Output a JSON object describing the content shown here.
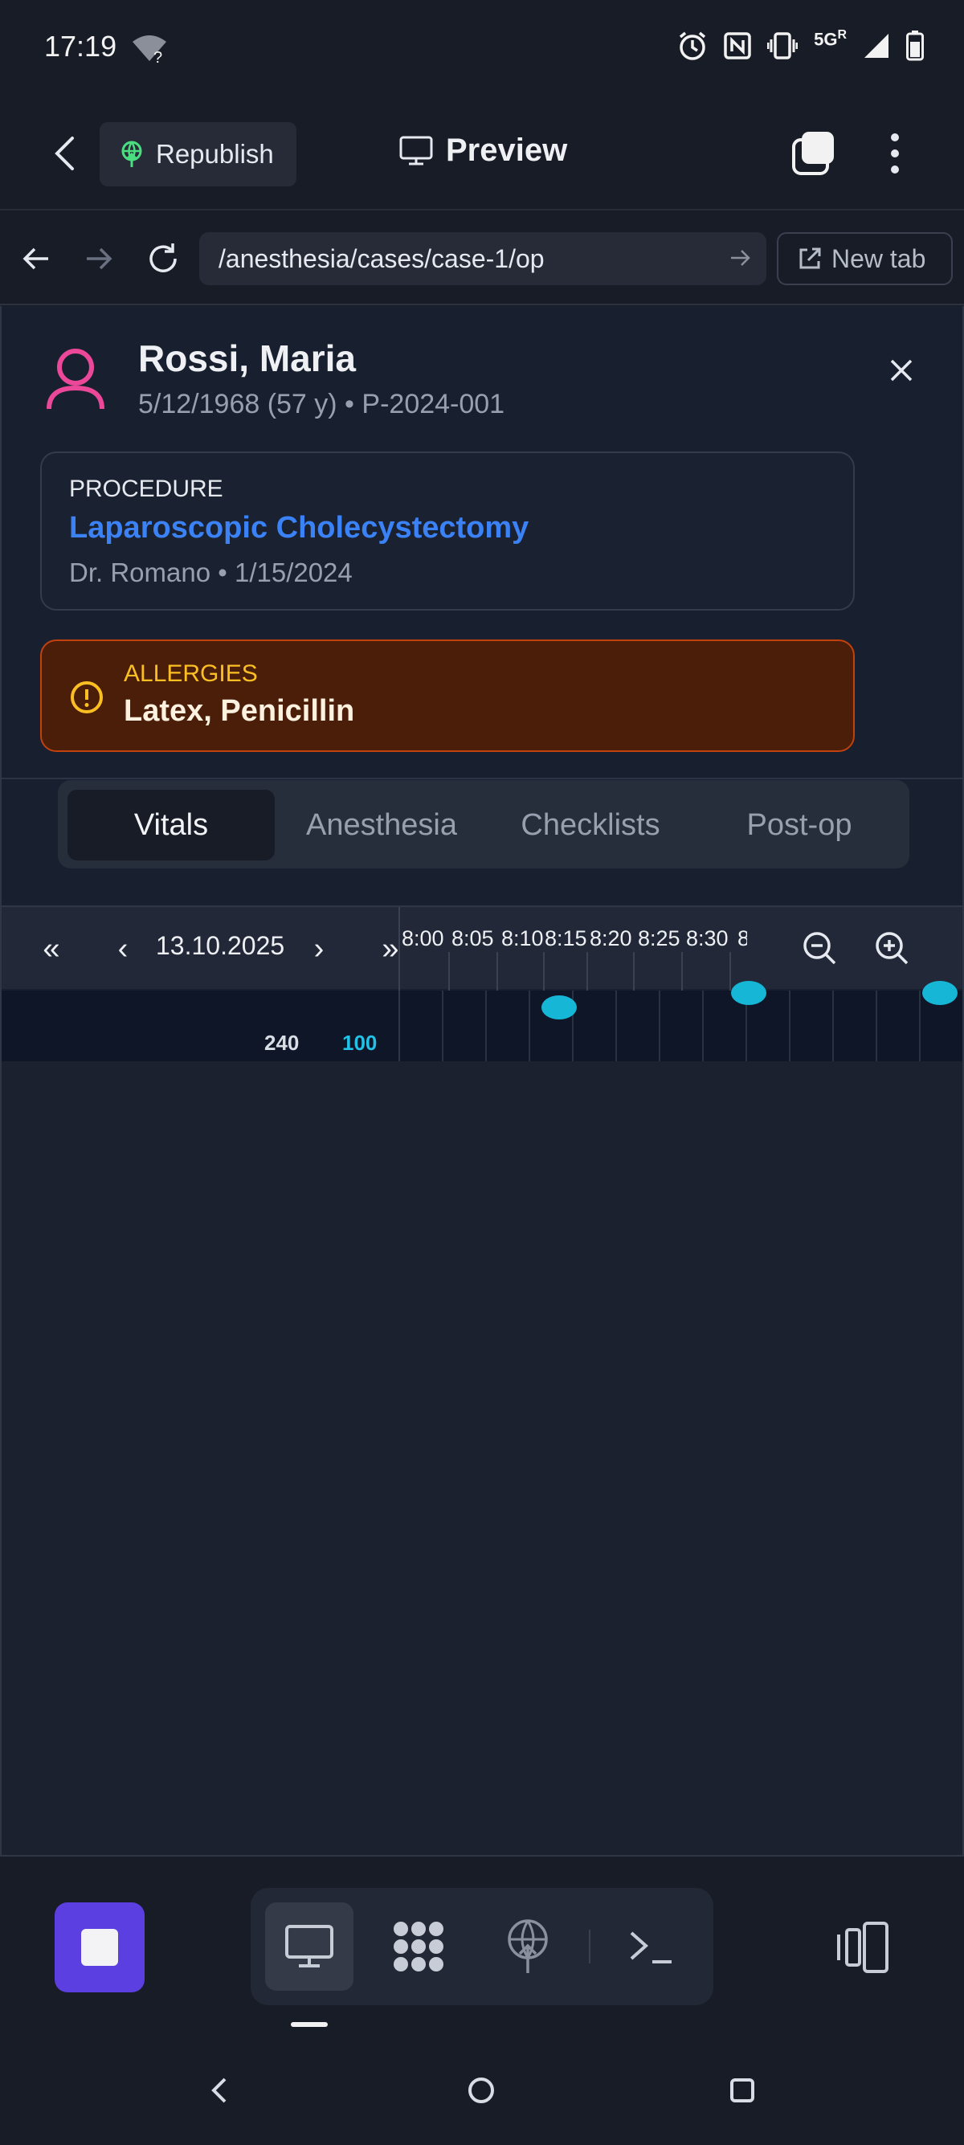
{
  "status_bar": {
    "time": "17:19",
    "network": "5G",
    "network_sub": "R",
    "icons": [
      "wifi-unknown-icon",
      "alarm-icon",
      "nfc-icon",
      "vibrate-icon",
      "signal-icon",
      "battery-icon"
    ]
  },
  "app_toolbar": {
    "back_icon": "chevron-left-icon",
    "republish_label": "Republish",
    "preview_label": "Preview",
    "tabs_icon": "tabs-icon",
    "more_icon": "more-vertical-icon"
  },
  "browser": {
    "url": "/anesthesia/cases/case-1/op",
    "new_tab_label": "New tab"
  },
  "patient": {
    "name": "Rossi, Maria",
    "meta": "5/12/1968 (57 y) • P-2024-001"
  },
  "procedure": {
    "kicker": "PROCEDURE",
    "title": "Laparoscopic Cholecystectomy",
    "meta": "Dr. Romano • 1/15/2024"
  },
  "allergies": {
    "kicker": "ALLERGIES",
    "values": "Latex, Penicillin"
  },
  "tabs": [
    {
      "label": "Vitals",
      "active": true
    },
    {
      "label": "Anesthesia",
      "active": false
    },
    {
      "label": "Checklists",
      "active": false
    },
    {
      "label": "Post-op",
      "active": false
    }
  ],
  "timeline": {
    "first_label": "«",
    "prev_label": "‹",
    "date": "13.10.2025",
    "next_label": "›",
    "last_label": "»",
    "ticks": [
      "8:00",
      "8:05",
      "8:10",
      "8:15",
      "8:20",
      "8:25",
      "8:30",
      "8"
    ]
  },
  "vitals": {
    "scale_left": "240",
    "scale_right": "100"
  },
  "colors": {
    "accent": "#3b82f6",
    "allergy_bg": "#4a1e08",
    "allergy_border": "#c2410c",
    "allergy_kicker": "#fbbf24",
    "vital_cyan": "#16b7d6",
    "stop_button": "#5b3fe0",
    "patient_icon": "#ec4899",
    "republish_icon": "#4ade80"
  }
}
